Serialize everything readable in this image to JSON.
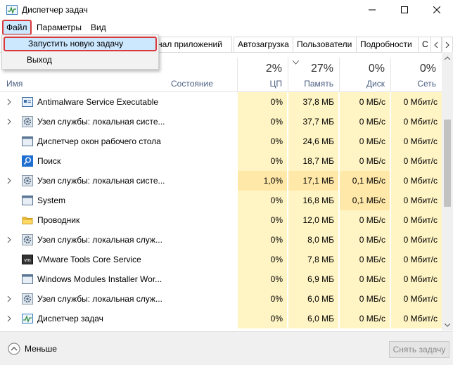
{
  "window": {
    "title": "Диспетчер задач",
    "icon": "task-manager-icon"
  },
  "menu": {
    "file": "Файл",
    "params": "Параметры",
    "view": "Вид"
  },
  "dropdown": {
    "run_new_task": "Запустить новую задачу",
    "exit": "Выход"
  },
  "tabs": [
    "нал приложений",
    "Автозагрузка",
    "Пользователи",
    "Подробности",
    "С"
  ],
  "header": {
    "name": "Имя",
    "state": "Состояние",
    "cpu_pct": "2%",
    "cpu_label": "ЦП",
    "mem_pct": "27%",
    "mem_label": "Память",
    "disk_pct": "0%",
    "disk_label": "Диск",
    "net_pct": "0%",
    "net_label": "Сеть"
  },
  "processes": [
    {
      "name": "Antimalware Service Executable",
      "icon": "defender-icon",
      "expandable": true,
      "cpu": "0%",
      "mem": "37,8 МБ",
      "disk": "0 МБ/с",
      "net": "0 Мбит/с"
    },
    {
      "name": "Узел службы: локальная систе...",
      "icon": "gear-icon",
      "expandable": true,
      "cpu": "0%",
      "mem": "37,7 МБ",
      "disk": "0 МБ/с",
      "net": "0 Мбит/с"
    },
    {
      "name": "Диспетчер окон рабочего стола",
      "icon": "window-icon",
      "expandable": false,
      "cpu": "0%",
      "mem": "24,6 МБ",
      "disk": "0 МБ/с",
      "net": "0 Мбит/с"
    },
    {
      "name": "Поиск",
      "icon": "search-icon",
      "expandable": false,
      "cpu": "0%",
      "mem": "18,7 МБ",
      "disk": "0 МБ/с",
      "net": "0 Мбит/с"
    },
    {
      "name": "Узел службы: локальная систе...",
      "icon": "gear-icon",
      "expandable": true,
      "cpu": "1,0%",
      "mem": "17,1 МБ",
      "disk": "0,1 МБ/с",
      "net": "0 Мбит/с"
    },
    {
      "name": "System",
      "icon": "window-icon",
      "expandable": false,
      "cpu": "0%",
      "mem": "16,8 МБ",
      "disk": "0,1 МБ/с",
      "net": "0 Мбит/с"
    },
    {
      "name": "Проводник",
      "icon": "folder-icon",
      "expandable": false,
      "cpu": "0%",
      "mem": "12,0 МБ",
      "disk": "0 МБ/с",
      "net": "0 Мбит/с"
    },
    {
      "name": "Узел службы: локальная служ...",
      "icon": "gear-icon",
      "expandable": true,
      "cpu": "0%",
      "mem": "8,0 МБ",
      "disk": "0 МБ/с",
      "net": "0 Мбит/с"
    },
    {
      "name": "VMware Tools Core Service",
      "icon": "vmware-icon",
      "expandable": false,
      "cpu": "0%",
      "mem": "7,8 МБ",
      "disk": "0 МБ/с",
      "net": "0 Мбит/с"
    },
    {
      "name": "Windows Modules Installer Wor...",
      "icon": "window-icon",
      "expandable": false,
      "cpu": "0%",
      "mem": "6,9 МБ",
      "disk": "0 МБ/с",
      "net": "0 Мбит/с"
    },
    {
      "name": "Узел службы: локальная служ...",
      "icon": "gear-icon",
      "expandable": true,
      "cpu": "0%",
      "mem": "6,0 МБ",
      "disk": "0 МБ/с",
      "net": "0 Мбит/с"
    },
    {
      "name": "Диспетчер задач",
      "icon": "task-manager-icon",
      "expandable": true,
      "cpu": "0%",
      "mem": "6,0 МБ",
      "disk": "0 МБ/с",
      "net": "0 Мбит/с"
    }
  ],
  "footer": {
    "less": "Меньше",
    "end_task": "Снять задачу"
  }
}
